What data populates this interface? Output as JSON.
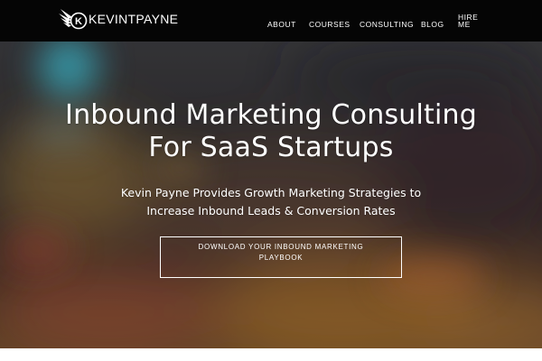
{
  "brand": {
    "logo_letter": "K",
    "name": "KEVINTPAYNE"
  },
  "nav": {
    "items": [
      {
        "label": "ABOUT"
      },
      {
        "label": "COURSES"
      },
      {
        "label": "CONSULTING"
      },
      {
        "label": "BLOG"
      },
      {
        "label": "HIRE ME",
        "line1": "HIRE",
        "line2": "ME"
      }
    ]
  },
  "hero": {
    "title_line1": "Inbound Marketing Consulting",
    "title_line2": "For SaaS Startups",
    "subtitle_line1": "Kevin Payne Provides Growth Marketing Strategies to",
    "subtitle_line2": "Increase Inbound Leads & Conversion Rates",
    "cta_line1": "DOWNLOAD YOUR INBOUND MARKETING",
    "cta_line2": "PLAYBOOK"
  },
  "colors": {
    "navbar_bg": "#050505",
    "text": "#ffffff",
    "hero_base": "#2d2a2c",
    "accent_teal": "#3fb5c8",
    "accent_orange": "#c8643a"
  }
}
